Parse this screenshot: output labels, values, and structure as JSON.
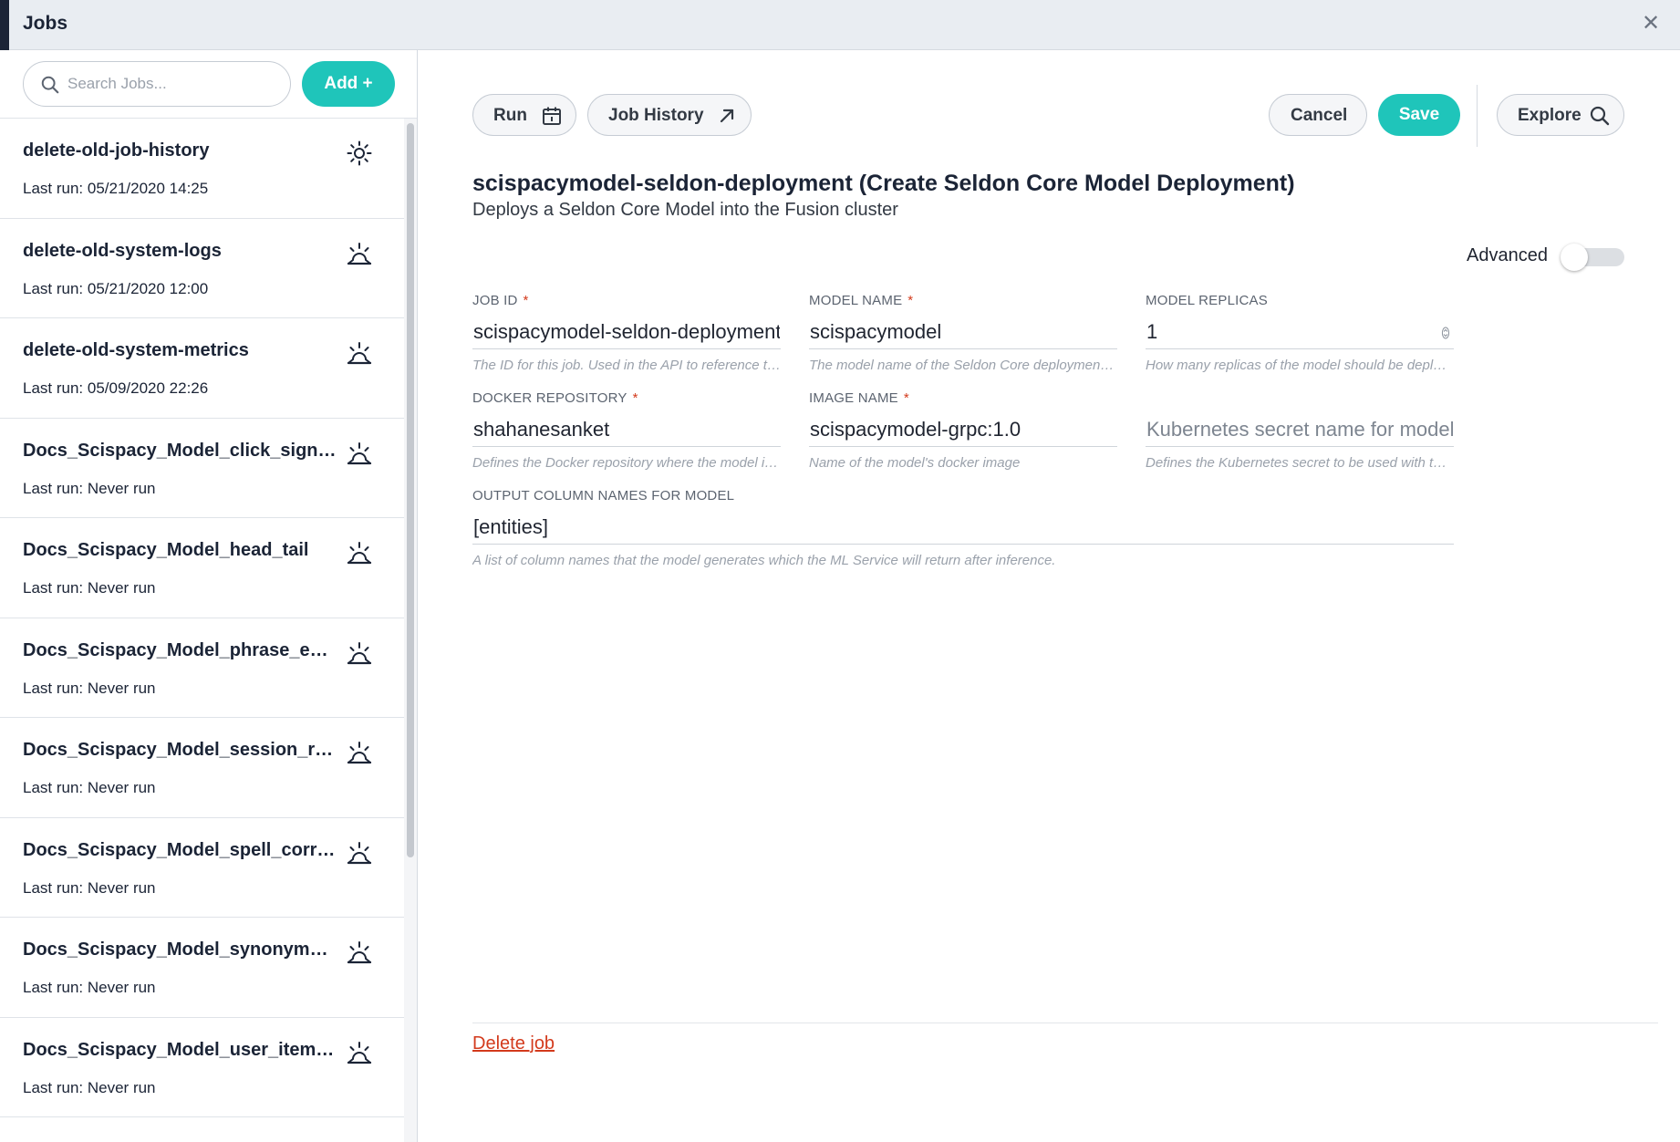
{
  "window": {
    "title": "Jobs"
  },
  "sidebar": {
    "search": {
      "placeholder": "Search Jobs..."
    },
    "add_label": "Add +",
    "jobs": [
      {
        "name": "delete-old-job-history",
        "last_run": "Last run: 05/21/2020 14:25",
        "icon": "sun-icon"
      },
      {
        "name": "delete-old-system-logs",
        "last_run": "Last run: 05/21/2020 12:00",
        "icon": "sunrise-icon"
      },
      {
        "name": "delete-old-system-metrics",
        "last_run": "Last run: 05/09/2020 22:26",
        "icon": "sunrise-icon"
      },
      {
        "name": "Docs_Scispacy_Model_click_signal...",
        "last_run": "Last run: Never run",
        "icon": "sunrise-icon"
      },
      {
        "name": "Docs_Scispacy_Model_head_tail",
        "last_run": "Last run: Never run",
        "icon": "sunrise-icon"
      },
      {
        "name": "Docs_Scispacy_Model_phrase_extr...",
        "last_run": "Last run: Never run",
        "icon": "sunrise-icon"
      },
      {
        "name": "Docs_Scispacy_Model_session_roll...",
        "last_run": "Last run: Never run",
        "icon": "sunrise-icon"
      },
      {
        "name": "Docs_Scispacy_Model_spell_correc...",
        "last_run": "Last run: Never run",
        "icon": "sunrise-icon"
      },
      {
        "name": "Docs_Scispacy_Model_synonym_d...",
        "last_run": "Last run: Never run",
        "icon": "sunrise-icon"
      },
      {
        "name": "Docs_Scispacy_Model_user_item_...",
        "last_run": "Last run: Never run",
        "icon": "sunrise-icon"
      }
    ]
  },
  "toolbar": {
    "run_label": "Run",
    "job_history_label": "Job History",
    "cancel_label": "Cancel",
    "save_label": "Save",
    "explore_label": "Explore"
  },
  "job": {
    "title": "scispacymodel-seldon-deployment (Create Seldon Core Model Deployment)",
    "description": "Deploys a Seldon Core Model into the Fusion cluster",
    "advanced_label": "Advanced",
    "advanced_on": false
  },
  "fields": {
    "job_id": {
      "label": "JOB ID",
      "value": "scispacymodel-seldon-deployment",
      "help": "The ID for this job. Used in the API to reference this j..."
    },
    "model_name": {
      "label": "MODEL NAME",
      "value": "scispacymodel",
      "help": "The model name of the Seldon Core deployment to d..."
    },
    "model_replicas": {
      "label": "MODEL REPLICAS",
      "value": "1",
      "help": "How many replicas of the model should be deployed ..."
    },
    "docker_repository": {
      "label": "DOCKER REPOSITORY",
      "value": "shahanesanket",
      "help": "Defines the Docker repository where the model imag..."
    },
    "image_name": {
      "label": "IMAGE NAME",
      "value": "scispacymodel-grpc:1.0",
      "help": "Name of the model's docker image"
    },
    "k8s_secret": {
      "placeholder": "Kubernetes secret name for model r...",
      "help": "Defines the Kubernetes secret to be used with the D..."
    },
    "output_columns": {
      "label": "OUTPUT COLUMN NAMES FOR MODEL",
      "value": "[entities]",
      "help": "A list of column names that the model generates which the ML Service will return after inference."
    }
  },
  "footer": {
    "delete_label": "Delete job"
  },
  "colors": {
    "accent": "#1fc5ba",
    "danger": "#d33a1c",
    "navy": "#1b2436"
  }
}
